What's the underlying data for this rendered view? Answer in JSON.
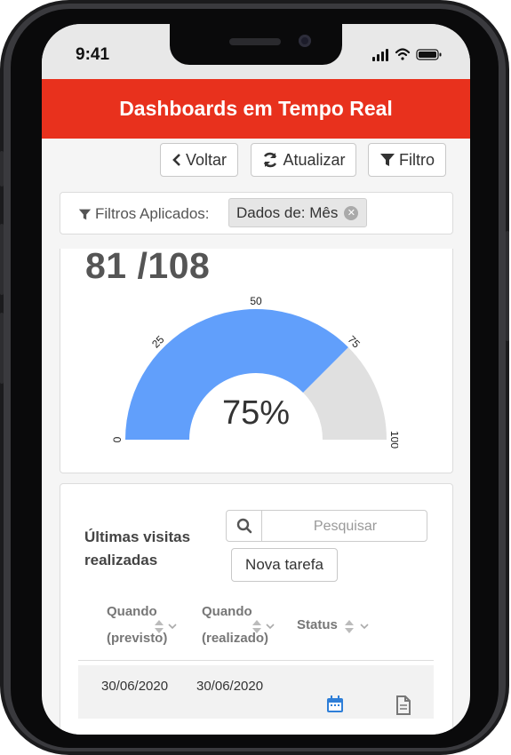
{
  "status_bar": {
    "time": "9:41"
  },
  "header": {
    "title": "Dashboards em Tempo Real"
  },
  "toolbar": {
    "back_label": "Voltar",
    "refresh_label": "Atualizar",
    "filter_label": "Filtro"
  },
  "filters": {
    "label": "Filtros Aplicados:",
    "chips": [
      {
        "label": "Dados de: Mês"
      }
    ]
  },
  "metric": {
    "value": "81 /108"
  },
  "gauge": {
    "center_label": "75%",
    "value": 75,
    "min": 0,
    "max": 100,
    "tick_labels": [
      "0",
      "25",
      "50",
      "75",
      "100"
    ],
    "fill_color": "#619ffb",
    "track_color": "#e0e0e0"
  },
  "visits": {
    "title": "Últimas visitas realizadas",
    "search_placeholder": "Pesquisar",
    "new_task_label": "Nova tarefa",
    "columns": [
      {
        "line1": "Quando",
        "line2": "(previsto)"
      },
      {
        "line1": "Quando",
        "line2": "(realizado)"
      },
      {
        "line1": "Status",
        "line2": ""
      }
    ],
    "rows": [
      {
        "planned": "30/06/2020",
        "done": "30/06/2020",
        "status_icon": "calendar-icon",
        "action_icon": "document-icon"
      }
    ]
  },
  "colors": {
    "brand": "#e8311d",
    "gauge_fill": "#619ffb",
    "status_icon": "#2f7fd8"
  }
}
